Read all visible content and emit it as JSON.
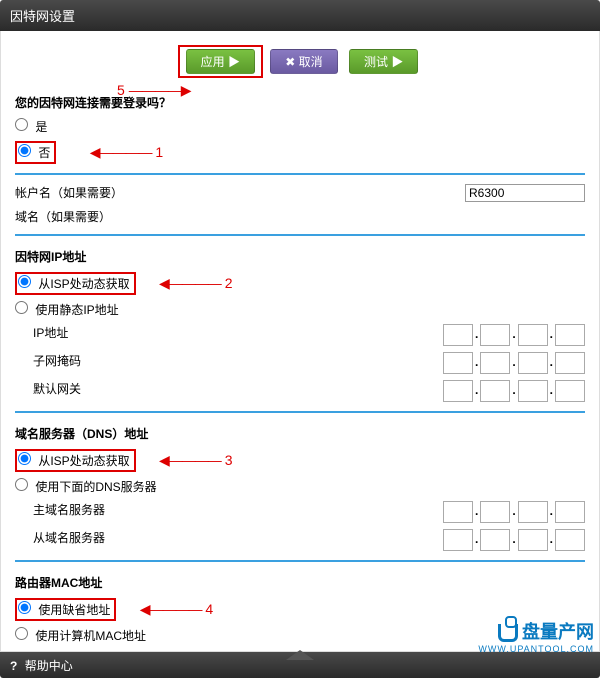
{
  "titlebar": "因特网设置",
  "buttons": {
    "apply": "应用 ▶",
    "cancel": "✖ 取消",
    "test": "测试 ▶"
  },
  "annotations": {
    "a5": "5",
    "a1": "1",
    "a2": "2",
    "a3": "3",
    "a4": "4",
    "arrowL": "————▶",
    "arrowR": "◀————"
  },
  "login": {
    "question": "您的因特网连接需要登录吗？",
    "yes": "是",
    "no": "否"
  },
  "account": {
    "user_label": "帐户名（如果需要）",
    "domain_label": "域名（如果需要）",
    "user_value": "R6300"
  },
  "ip": {
    "title": "因特网IP地址",
    "dynamic": "从ISP处动态获取",
    "static": "使用静态IP地址",
    "addr": "IP地址",
    "mask": "子网掩码",
    "gw": "默认网关"
  },
  "dns": {
    "title": "域名服务器（DNS）地址",
    "dynamic": "从ISP处动态获取",
    "manual": "使用下面的DNS服务器",
    "primary": "主域名服务器",
    "secondary": "从域名服务器"
  },
  "mac": {
    "title": "路由器MAC地址",
    "default": "使用缺省地址",
    "pcmac": "使用计算机MAC地址"
  },
  "help": "帮助中心",
  "watermark": {
    "main": "盘量产网",
    "sub": "WWW.UPANTOOL.COM"
  }
}
